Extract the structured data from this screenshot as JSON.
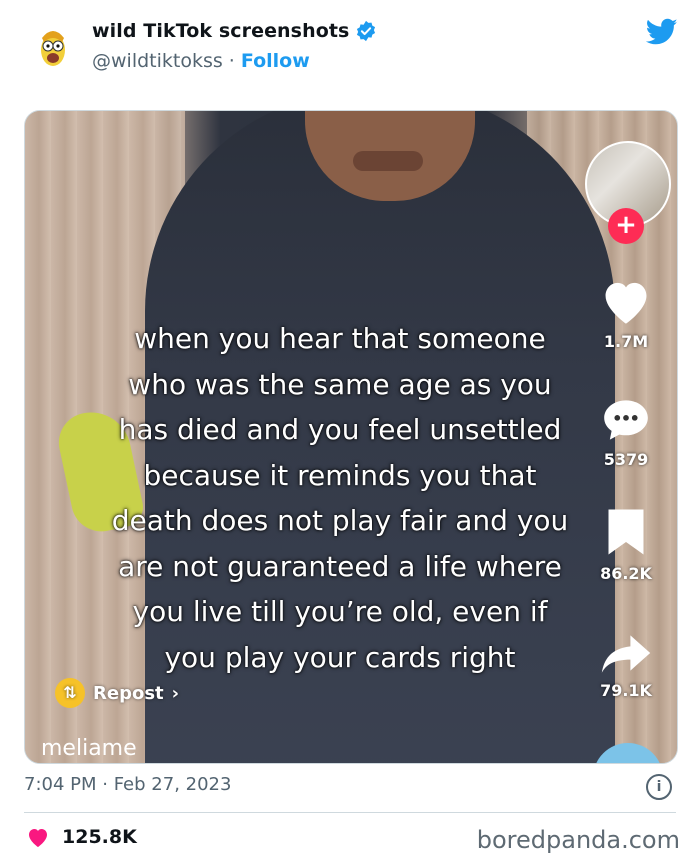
{
  "account": {
    "display_name": "wild TikTok screenshots",
    "handle": "@wildtiktokss",
    "separator": " · ",
    "follow_label": "Follow",
    "verified": true
  },
  "tiktok": {
    "caption": "when you hear that someone who was the same age as you has died and you feel unsettled because it reminds you that death does not play fair and you are not guaranteed a life where you live till you’re old, even if you play your cards right",
    "likes": "1.7M",
    "comments": "5379",
    "saves": "86.2K",
    "shares": "79.1K",
    "repost_label": "Repost",
    "repost_arrow": "›",
    "creator": "meliame",
    "plus_symbol": "+"
  },
  "tweet": {
    "timestamp": "7:04 PM · Feb 27, 2023",
    "like_count": "125.8K",
    "info_symbol": "i"
  },
  "watermark": "boredpanda.com",
  "colors": {
    "twitter_blue": "#1d9bf0",
    "tiktok_red": "#fe2c55",
    "like_red": "#f91880",
    "muted": "#536471"
  },
  "icons": [
    "avatar-icon",
    "verified-icon",
    "twitter-bird-icon",
    "heart-icon",
    "comment-icon",
    "bookmark-icon",
    "share-icon",
    "repost-icon",
    "info-icon"
  ]
}
